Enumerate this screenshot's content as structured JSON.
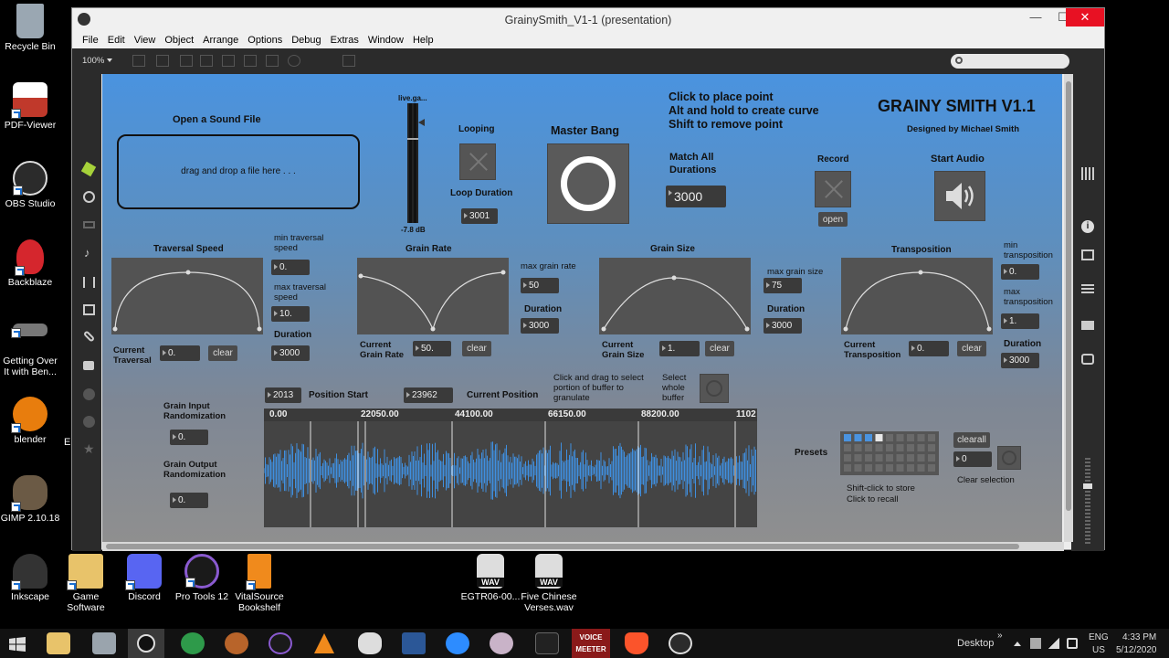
{
  "desktop": {
    "icons": [
      {
        "label": "Recycle Bin",
        "color": "#9aa7b2"
      },
      {
        "label": "PDF-Viewer",
        "color": "#c0392b"
      },
      {
        "label": "OBS Studio",
        "color": "#2b2b2b"
      },
      {
        "label": "Backblaze",
        "color": "#d5262d"
      },
      {
        "label": "Getting Over It with Ben...",
        "color": "#777"
      },
      {
        "label": "blender",
        "color": "#e87d0d"
      },
      {
        "label": "GIMP 2.10.18",
        "color": "#6b5a45"
      },
      {
        "label": "Inkscape",
        "color": "#333"
      }
    ],
    "bottom_icons": [
      {
        "label": "Game Software",
        "color": "#e8c36a"
      },
      {
        "label": "Discord",
        "color": "#5865f2"
      },
      {
        "label": "Pro Tools 12",
        "color": "#5a3a8a"
      },
      {
        "label": "VitalSource Bookshelf",
        "color": "#f08a1c"
      },
      {
        "label": "EGTR06-00...",
        "color": "#ddd"
      },
      {
        "label": "Five Chinese Verses.wav",
        "color": "#ddd"
      }
    ],
    "wav_badge": "WAV"
  },
  "window": {
    "title": "GrainySmith_V1-1 (presentation)",
    "controls": {
      "minimize": "—",
      "maximize": "☐",
      "close": "✕"
    },
    "menu": [
      "File",
      "Edit",
      "View",
      "Object",
      "Arrange",
      "Options",
      "Debug",
      "Extras",
      "Window",
      "Help"
    ],
    "zoom": "100%"
  },
  "patch": {
    "title": "GRAINY SMITH V1.1",
    "subtitle": "Designed by Michael Smith",
    "instructions": [
      "Click to place point",
      "Alt and hold to create curve",
      "Shift to remove point"
    ],
    "open_sound": "Open a Sound File",
    "drop_hint": "drag and drop a file here . . .",
    "meter_label": "live.ga...",
    "meter_db": "-7.8 dB",
    "looping": "Looping",
    "loop_duration_label": "Loop Duration",
    "loop_duration": "3001",
    "master_bang": "Master Bang",
    "match_all": "Match  All",
    "durations": "Durations",
    "match_value": "3000",
    "record": "Record",
    "open_btn": "open",
    "start_audio": "Start Audio",
    "traversal": {
      "title": "Traversal Speed",
      "min_label": "min traversal speed",
      "min": "0.",
      "max_label": "max traversal speed",
      "max": "10.",
      "duration_label": "Duration",
      "duration": "3000",
      "current_label": "Current Traversal",
      "current": "0.",
      "clear": "clear"
    },
    "grain_rate": {
      "title": "Grain Rate",
      "max_label": "max grain rate",
      "max": "50",
      "duration_label": "Duration",
      "duration": "3000",
      "current_label": "Current Grain Rate",
      "current": "50.",
      "clear": "clear"
    },
    "grain_size": {
      "title": "Grain Size",
      "max_label": "max grain size",
      "max": "75",
      "duration_label": "Duration",
      "duration": "3000",
      "current_label": "Current Grain Size",
      "current": "1.",
      "clear": "clear"
    },
    "transposition": {
      "title": "Transposition",
      "min_label": "min transposition",
      "min": "0.",
      "max_label": "max transposition",
      "max": "1.",
      "duration_label": "Duration",
      "duration": "3000",
      "current_label": "Current Transposition",
      "current": "0.",
      "clear": "clear"
    },
    "position_start_value": "2013",
    "position_start_label": "Position Start",
    "current_position_value": "23962",
    "current_position_label": "Current Position",
    "select_hint": "Click and drag to select portion of buffer to granulate",
    "select_whole": "Select whole buffer",
    "grain_input_label": "Grain Input Randomization",
    "grain_input": "0.",
    "grain_output_label": "Grain Output Randomization",
    "grain_output": "0.",
    "ruler": [
      "0.00",
      "22050.00",
      "44100.00",
      "66150.00",
      "88200.00",
      "1102"
    ],
    "presets_label": "Presets",
    "presets_hint1": "Shift-click to store",
    "presets_hint2": "Click to recall",
    "clearall": "clearall",
    "preset_num": "0",
    "clear_selection": "Clear selection"
  },
  "taskbar": {
    "desktop": "Desktop",
    "lang": "ENG",
    "region": "US",
    "time": "4:33 PM",
    "date": "5/12/2020",
    "chevron": "»",
    "voicemeeter_top": "VOICE",
    "voicemeeter_bottom": "MEETER"
  },
  "colors": {
    "accent": "#4a93df",
    "waveform": "#3f8fe0"
  }
}
